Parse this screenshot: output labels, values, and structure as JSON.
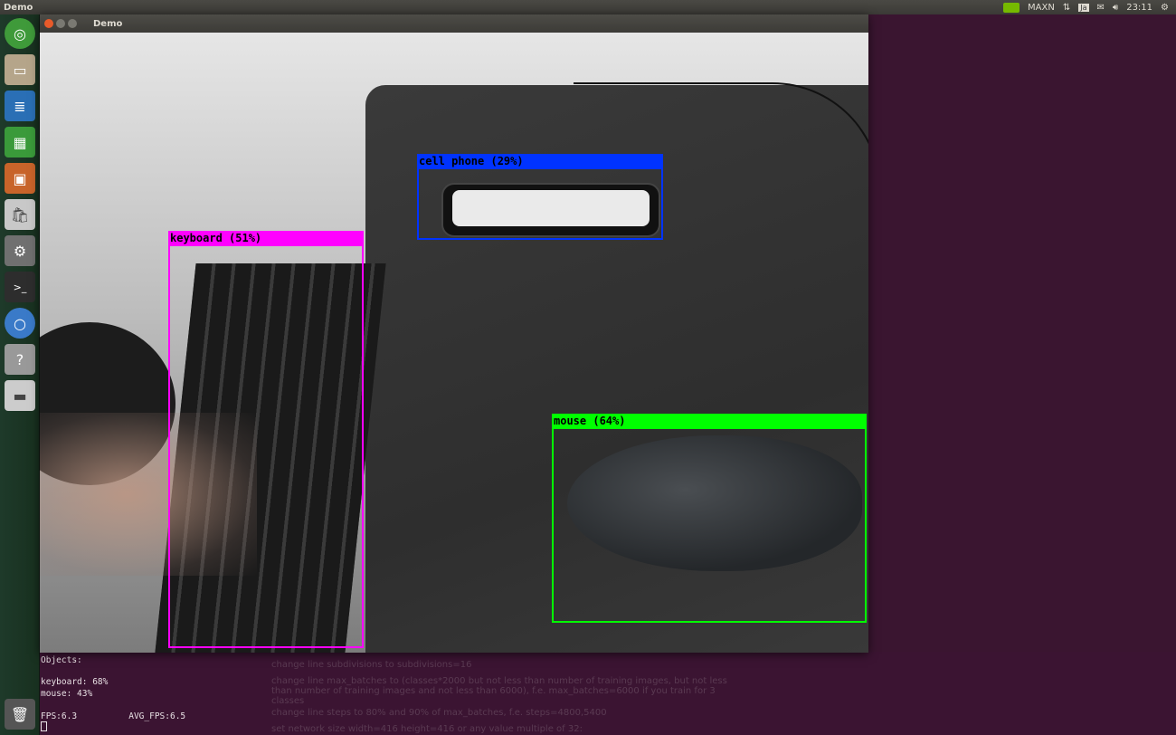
{
  "topbar": {
    "app_title": "Demo",
    "gpu_mode": "MAXN",
    "keyboard_layout": "Ja",
    "time": "23:11",
    "icons": [
      "nvidia-icon",
      "network-icon",
      "keyboard-icon",
      "mail-icon",
      "volume-icon",
      "power-gear-icon"
    ]
  },
  "launcher": {
    "items": [
      "ubuntu-dash",
      "files",
      "writer",
      "calc",
      "impress",
      "software-center",
      "system-settings",
      "terminal",
      "chromium",
      "help",
      "drive"
    ],
    "trash": "trash"
  },
  "window": {
    "title": "Demo"
  },
  "detections": [
    {
      "label": "keyboard (51%)",
      "color": "#ff00ff"
    },
    {
      "label": "cell phone (29%)",
      "color": "#0033ff"
    },
    {
      "label": "mouse (64%)",
      "color": "#00ff00"
    }
  ],
  "terminal": {
    "lines": [
      "Objects:",
      "",
      "keyboard: 68%",
      "mouse: 43%",
      "",
      "FPS:6.3          AVG_FPS:6.5"
    ]
  },
  "background_doc": {
    "bullets": [
      "change line subdivisions to subdivisions=16",
      "change line max_batches to (classes*2000 but not less than number of training images, but not less than number of training images and not less than 6000), f.e. max_batches=6000 if you train for 3 classes",
      "change line steps to 80% and 90% of max_batches, f.e. steps=4800,5400",
      "set network size width=416 height=416 or any value multiple of 32:"
    ]
  }
}
